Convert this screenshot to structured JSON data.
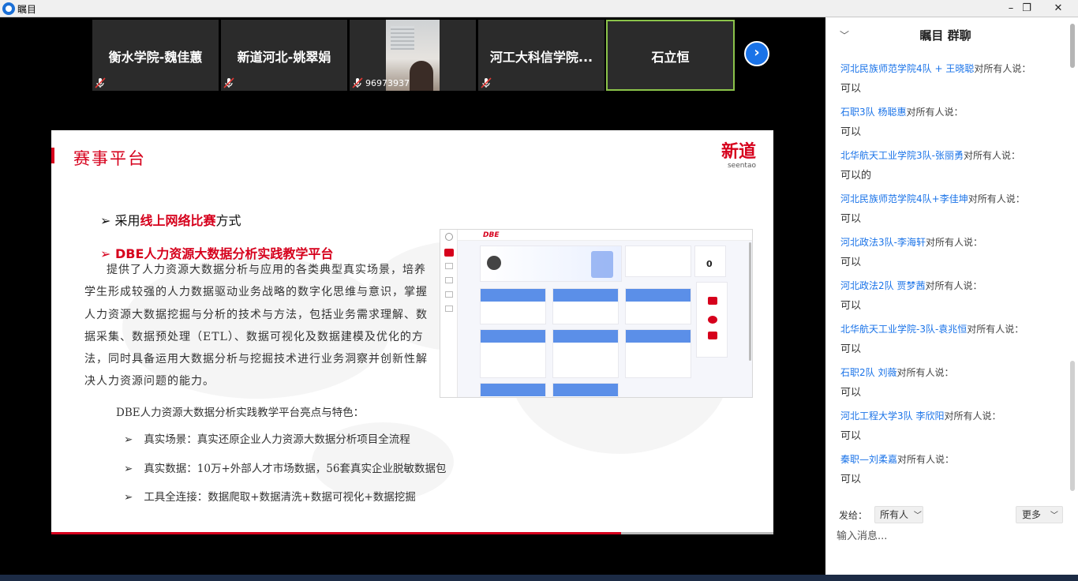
{
  "app": {
    "title": "瞩目"
  },
  "window_controls": {
    "minimize": "–",
    "restore": "❐",
    "close": "✕"
  },
  "participants": [
    {
      "name": "衡水学院-魏佳蕙",
      "muted": true
    },
    {
      "name": "新道河北-姚翠娟",
      "muted": true
    },
    {
      "name": "",
      "id": "96973937",
      "muted": true,
      "video": true
    },
    {
      "name": "河工大科信学院...",
      "muted": true
    },
    {
      "name": "石立恒",
      "muted": false,
      "active": true
    }
  ],
  "next_icon": "chevron-right-icon",
  "slide": {
    "title": "赛事平台",
    "brand": {
      "cn": "新道",
      "en": "seentao"
    },
    "bullet1": {
      "prefix": "采用",
      "highlight": "线上网络比赛",
      "suffix": "方式"
    },
    "bullet2": "DBE人力资源大数据分析实践教学平台",
    "paragraph": "提供了人力资源大数据分析与应用的各类典型真实场景，培养学生形成较强的人力数据驱动业务战略的数字化思维与意识，掌握人力资源大数据挖掘与分析的技术与方法，包括业务需求理解、数据采集、数据预处理（ETL）、数据可视化及数据建模及优化的方法，同时具备运用大数据分析与挖掘技术进行业务洞察并创新性解决人力资源问题的能力。",
    "features_heading": "DBE人力资源大数据分析实践教学平台亮点与特色：",
    "features": [
      "真实场景：真实还原企业人力资源大数据分析项目全流程",
      "真实数据：10万+外部人才市场数据，56套真实企业脱敏数据包",
      "工具全连接：数据爬取+数据清洗+数据可视化+数据挖掘"
    ],
    "platform_logo": "DBE",
    "platform_zero": "0"
  },
  "chat": {
    "title": "瞩目 群聊",
    "to_all_label": "对所有人说：",
    "messages": [
      {
        "sender": "河北民族师范学院4队 + 王晓聪",
        "text": "可以"
      },
      {
        "sender": "石职3队  杨聪惠",
        "text": "可以"
      },
      {
        "sender": "北华航天工业学院3队-张丽勇",
        "text": "可以的"
      },
      {
        "sender": "河北民族师范学院4队+李佳坤",
        "text": "可以"
      },
      {
        "sender": "河北政法3队-李海轩",
        "text": "可以"
      },
      {
        "sender": "河北政法2队 贾梦茜",
        "text": "可以"
      },
      {
        "sender": "北华航天工业学院-3队-袁兆恒",
        "text": "可以"
      },
      {
        "sender": "石职2队 刘薇",
        "text": "可以"
      },
      {
        "sender": "河北工程大学3队 李欣阳",
        "text": "可以"
      },
      {
        "sender": "秦职—刘柔嘉",
        "text": "可以"
      }
    ],
    "send_to_label": "发给：",
    "send_to_value": "所有人",
    "more_label": "更多",
    "input_placeholder": "输入消息..."
  },
  "colors": {
    "brand_red": "#d6001c",
    "link_blue": "#1a73e8",
    "active_border": "#8bc34a"
  }
}
